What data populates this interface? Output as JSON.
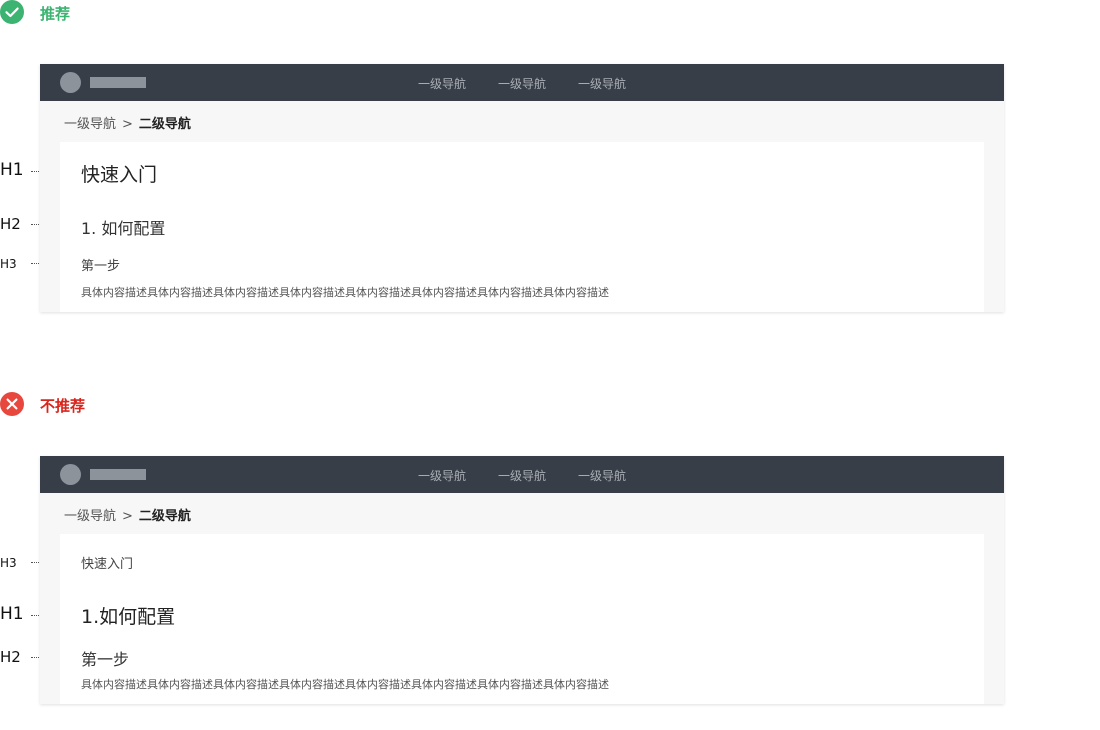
{
  "good": {
    "status_label": "推荐",
    "status_icon": "check-circle-icon",
    "status_color": "#3cb371",
    "topnav": [
      "一级导航",
      "一级导航",
      "一级导航"
    ],
    "breadcrumb": {
      "first": "一级导航",
      "separator": ">",
      "current": "二级导航"
    },
    "headings": [
      {
        "tag": "H1",
        "text": "快速入门"
      },
      {
        "tag": "H2",
        "text": "1. 如何配置"
      },
      {
        "tag": "H3",
        "text": "第一步"
      }
    ],
    "description": "具体内容描述具体内容描述具体内容描述具体内容描述具体内容描述具体内容描述具体内容描述具体内容描述"
  },
  "bad": {
    "status_label": "不推荐",
    "status_icon": "close-circle-icon",
    "status_color": "#d9261c",
    "topnav": [
      "一级导航",
      "一级导航",
      "一级导航"
    ],
    "breadcrumb": {
      "first": "一级导航",
      "separator": ">",
      "current": "二级导航"
    },
    "headings": [
      {
        "tag": "H3",
        "text": "快速入门"
      },
      {
        "tag": "H1",
        "text": "1.如何配置"
      },
      {
        "tag": "H2",
        "text": "第一步"
      }
    ],
    "description": "具体内容描述具体内容描述具体内容描述具体内容描述具体内容描述具体内容描述具体内容描述具体内容描述"
  },
  "colors": {
    "topbar": "#373e48",
    "page_background": "#f7f7f7",
    "card": "#ffffff"
  }
}
